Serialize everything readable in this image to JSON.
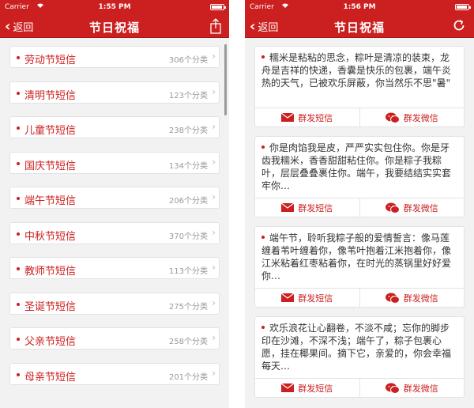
{
  "left_screen": {
    "status": {
      "carrier": "Carrier",
      "time": "1:55 PM"
    },
    "nav": {
      "back_label": "返回",
      "title": "节日祝福"
    },
    "items": [
      {
        "name": "劳动节短信",
        "count": "306个分类"
      },
      {
        "name": "清明节短信",
        "count": "123个分类"
      },
      {
        "name": "儿童节短信",
        "count": "238个分类"
      },
      {
        "name": "国庆节短信",
        "count": "134个分类"
      },
      {
        "name": "端午节短信",
        "count": "206个分类"
      },
      {
        "name": "中秋节短信",
        "count": "370个分类"
      },
      {
        "name": "教师节短信",
        "count": "113个分类"
      },
      {
        "name": "圣诞节短信",
        "count": "275个分类"
      },
      {
        "name": "父亲节短信",
        "count": "258个分类"
      },
      {
        "name": "母亲节短信",
        "count": "201个分类"
      }
    ]
  },
  "right_screen": {
    "status": {
      "carrier": "Carrier",
      "time": "1:56 PM"
    },
    "nav": {
      "back_label": "返回",
      "title": "节日祝福"
    },
    "sms_label": "群发短信",
    "wechat_label": "群发微信",
    "messages": [
      "糯米是粘粘的思念，粽叶是清凉的装束，龙舟是吉祥的快递，香囊是快乐的包裹，端午炎热的天气，已被欢乐屏蔽，你当然乐不思\"暑\"",
      "你是肉馅我是皮，严严实实包住你。你是牙齿我糯米，香香甜甜粘住你。你是粽子我粽叶，层层叠叠裹住你。端午，我要结结实实套牢你…",
      "端午节，聆听我粽子般的爱情誓言：像马莲缠着苇叶缠着你，像苇叶抱着江米抱着你，像江米粘着红枣粘着你，在时光的蒸锅里好好爱你…",
      "欢乐浪花让心翻卷，不淡不咸；忘你的脚步印在沙滩，不深不浅；端午了，粽子包裹心愿，挂在椰果间。摘下它，亲爱的，你会幸福每天…"
    ]
  },
  "colors": {
    "primary": "#cc1f1f",
    "background": "#f2f2f2"
  }
}
